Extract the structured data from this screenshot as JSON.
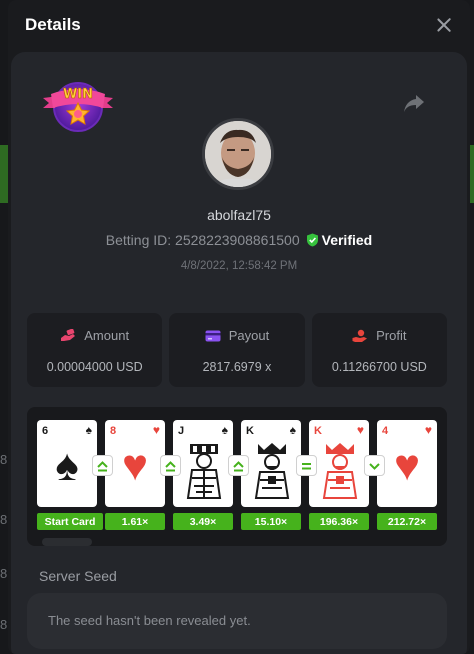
{
  "header": {
    "title": "Details"
  },
  "badge": {
    "text": "WIN"
  },
  "player": {
    "username": "abolfazl75",
    "betting_id_label": "Betting ID: 2528223908861500",
    "verified_label": "Verified",
    "timestamp": "4/8/2022, 12:58:42 PM"
  },
  "stats": [
    {
      "label": "Amount",
      "value": "0.00004000 USD",
      "icon": "amount-icon"
    },
    {
      "label": "Payout",
      "value": "2817.6979 x",
      "icon": "payout-card-icon"
    },
    {
      "label": "Profit",
      "value": "0.11266700 USD",
      "icon": "profit-hand-icon"
    }
  ],
  "cards": [
    {
      "rank": "6",
      "suit": "♠",
      "color": "black",
      "face": false
    },
    {
      "rank": "8",
      "suit": "♥",
      "color": "red",
      "face": false
    },
    {
      "rank": "J",
      "suit": "♠",
      "color": "black",
      "face": true
    },
    {
      "rank": "K",
      "suit": "♠",
      "color": "black",
      "face": true
    },
    {
      "rank": "K",
      "suit": "♥",
      "color": "red",
      "face": true
    },
    {
      "rank": "4",
      "suit": "♥",
      "color": "red",
      "face": false
    }
  ],
  "guesses": [
    "higher-or-equal",
    "higher-or-equal",
    "higher-or-equal",
    "equal",
    "lower-or-equal"
  ],
  "multipliers": [
    "Start Card",
    "1.61×",
    "3.49×",
    "15.10×",
    "196.36×",
    "212.72×"
  ],
  "seed": {
    "label": "Server Seed",
    "value": "The seed hasn't been revealed yet."
  },
  "colors": {
    "accent_green": "#46b21c",
    "verified_green": "#36c23d",
    "amount_icon": "#e8456e",
    "payout_icon": "#8a52f0",
    "profit_icon": "#e8453c"
  },
  "background_numbers": [
    "8",
    "8",
    "8",
    "8"
  ]
}
